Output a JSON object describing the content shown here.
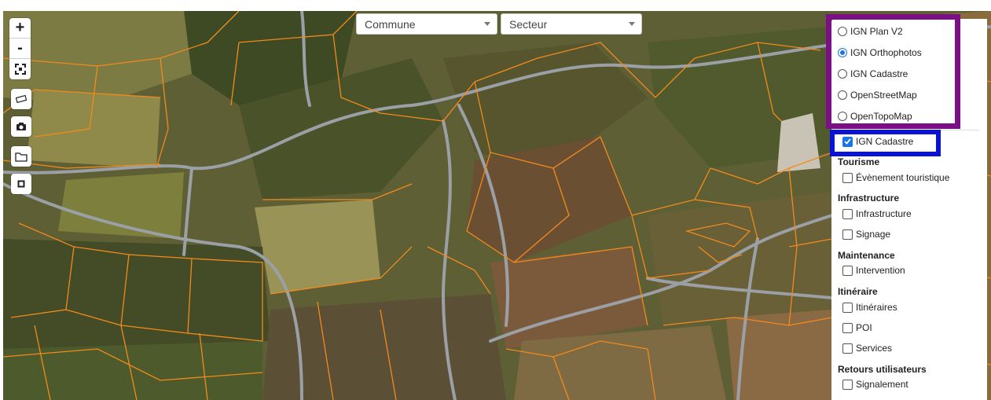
{
  "map": {
    "colors": {
      "parcel_line": "#f28a1c",
      "road": "#9aa0a6",
      "field_light": "#8f8a4a",
      "forest": "#3e4a24",
      "field_brown": "#6b4f33"
    },
    "controls": {
      "zoom_in": "+",
      "zoom_out": "-",
      "icons": [
        "fullscreen-icon",
        "ruler-icon",
        "camera-icon",
        "folder-icon",
        "square-draw-icon"
      ]
    }
  },
  "filters": {
    "commune": "Commune",
    "secteur": "Secteur"
  },
  "layers": {
    "base_layers": [
      {
        "label": "IGN Plan V2",
        "selected": false
      },
      {
        "label": "IGN Orthophotos",
        "selected": true
      },
      {
        "label": "IGN Cadastre",
        "selected": false
      },
      {
        "label": "OpenStreetMap",
        "selected": false
      },
      {
        "label": "OpenTopoMap",
        "selected": false
      }
    ],
    "overlay_cadastre": {
      "label": "IGN Cadastre",
      "checked": true
    },
    "groups": [
      {
        "title": "Tourisme",
        "items": [
          "Évènement touristique"
        ]
      },
      {
        "title": "Infrastructure",
        "items": [
          "Infrastructure",
          "Signage"
        ]
      },
      {
        "title": "Maintenance",
        "items": [
          "Intervention"
        ]
      },
      {
        "title": "Itinéraire",
        "items": [
          "Itinéraires",
          "POI",
          "Services"
        ]
      },
      {
        "title": "Retours utilisateurs",
        "items": [
          "Signalement"
        ]
      }
    ]
  }
}
